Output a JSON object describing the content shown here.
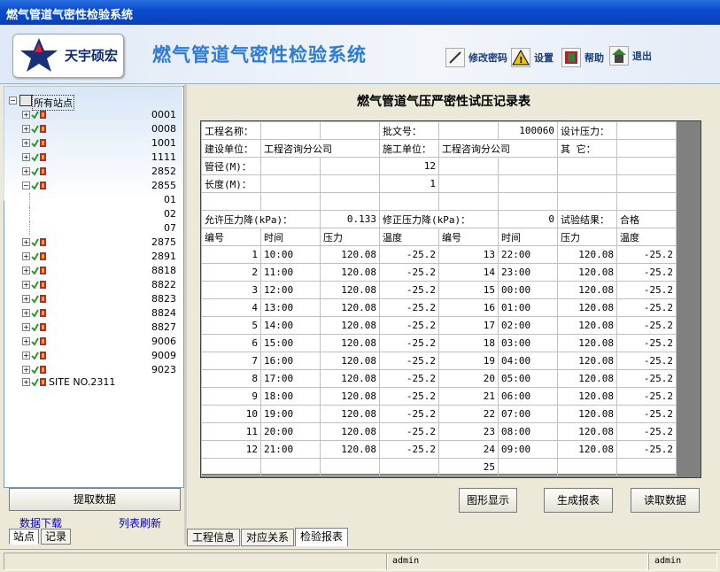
{
  "window": {
    "title": "燃气管道气密性检验系统"
  },
  "header": {
    "logo_text": "天宇硕宏",
    "title": "燃气管道气密性检验系统",
    "toolbar": [
      {
        "label": "修改密码",
        "icon": "pen-icon"
      },
      {
        "label": "设置",
        "icon": "warning-icon"
      },
      {
        "label": "帮助",
        "icon": "help-book-icon"
      },
      {
        "label": "退出",
        "icon": "exit-icon"
      }
    ]
  },
  "sidebar": {
    "root_label": "所有站点",
    "items": [
      {
        "code": "0001",
        "expanded": false
      },
      {
        "code": "0008",
        "expanded": false
      },
      {
        "code": "1001",
        "expanded": false
      },
      {
        "code": "1111",
        "expanded": false
      },
      {
        "code": "2852",
        "expanded": false
      },
      {
        "code": "2855",
        "expanded": true,
        "children": [
          "01",
          "02",
          "07"
        ]
      },
      {
        "code": "2875",
        "expanded": false
      },
      {
        "code": "2891",
        "expanded": false
      },
      {
        "code": "8818",
        "expanded": false
      },
      {
        "code": "8822",
        "expanded": false
      },
      {
        "code": "8823",
        "expanded": false
      },
      {
        "code": "8824",
        "expanded": false
      },
      {
        "code": "8827",
        "expanded": false
      },
      {
        "code": "9006",
        "expanded": false
      },
      {
        "code": "9009",
        "expanded": false
      },
      {
        "code": "9023",
        "expanded": false
      }
    ],
    "last_item": "SITE NO.2311",
    "extract_button": "提取数据",
    "link_download": "数据下载",
    "link_refresh": "列表刷新",
    "tabs": [
      "站点",
      "记录"
    ]
  },
  "report": {
    "title": "燃气管道气压严密性试压记录表",
    "project_name_label": "工程名称：",
    "approval_no_label": "批文号：",
    "approval_no": "100060",
    "design_pressure_label": "设计压力：",
    "builder_label": "建设单位：",
    "builder": "工程咨询分公司",
    "constructor_label": "施工单位：",
    "constructor": "工程咨询分公司",
    "other_label": "其    它：",
    "diameter_label": "管径(M)：",
    "diameter": "12",
    "length_label": "长度(M)：",
    "length": "1",
    "allowed_drop_label": "允许压力降(kPa)：",
    "allowed_drop": "0.133",
    "corrected_drop_label": "修正压力降(kPa)：",
    "corrected_drop": "0",
    "result_label": "试验结果：",
    "result": "合格",
    "col_headers": [
      "编号",
      "时间",
      "压力",
      "温度",
      "编号",
      "时间",
      "压力",
      "温度"
    ],
    "left_rows": [
      [
        "1",
        "10:00",
        "120.08",
        "-25.2"
      ],
      [
        "2",
        "11:00",
        "120.08",
        "-25.2"
      ],
      [
        "3",
        "12:00",
        "120.08",
        "-25.2"
      ],
      [
        "4",
        "13:00",
        "120.08",
        "-25.2"
      ],
      [
        "5",
        "14:00",
        "120.08",
        "-25.2"
      ],
      [
        "6",
        "15:00",
        "120.08",
        "-25.2"
      ],
      [
        "7",
        "16:00",
        "120.08",
        "-25.2"
      ],
      [
        "8",
        "17:00",
        "120.08",
        "-25.2"
      ],
      [
        "9",
        "18:00",
        "120.08",
        "-25.2"
      ],
      [
        "10",
        "19:00",
        "120.08",
        "-25.2"
      ],
      [
        "11",
        "20:00",
        "120.08",
        "-25.2"
      ],
      [
        "12",
        "21:00",
        "120.08",
        "-25.2"
      ],
      [
        "",
        "",
        "",
        ""
      ]
    ],
    "right_rows": [
      [
        "13",
        "22:00",
        "120.08",
        "-25.2"
      ],
      [
        "14",
        "23:00",
        "120.08",
        "-25.2"
      ],
      [
        "15",
        "00:00",
        "120.08",
        "-25.2"
      ],
      [
        "16",
        "01:00",
        "120.08",
        "-25.2"
      ],
      [
        "17",
        "02:00",
        "120.08",
        "-25.2"
      ],
      [
        "18",
        "03:00",
        "120.08",
        "-25.2"
      ],
      [
        "19",
        "04:00",
        "120.08",
        "-25.2"
      ],
      [
        "20",
        "05:00",
        "120.08",
        "-25.2"
      ],
      [
        "21",
        "06:00",
        "120.08",
        "-25.2"
      ],
      [
        "22",
        "07:00",
        "120.08",
        "-25.2"
      ],
      [
        "23",
        "08:00",
        "120.08",
        "-25.2"
      ],
      [
        "24",
        "09:00",
        "120.08",
        "-25.2"
      ],
      [
        "25",
        "",
        "",
        ""
      ]
    ],
    "buttons": [
      "图形显示",
      "生成报表",
      "读取数据"
    ]
  },
  "bottom_tabs": [
    "工程信息",
    "对应关系",
    "检验报表"
  ],
  "status": {
    "user1": "admin",
    "user2": "admin"
  },
  "colors": {
    "title_bar": "#0a4ccf",
    "header_title": "#2d7bd6",
    "link": "#0000cc"
  }
}
